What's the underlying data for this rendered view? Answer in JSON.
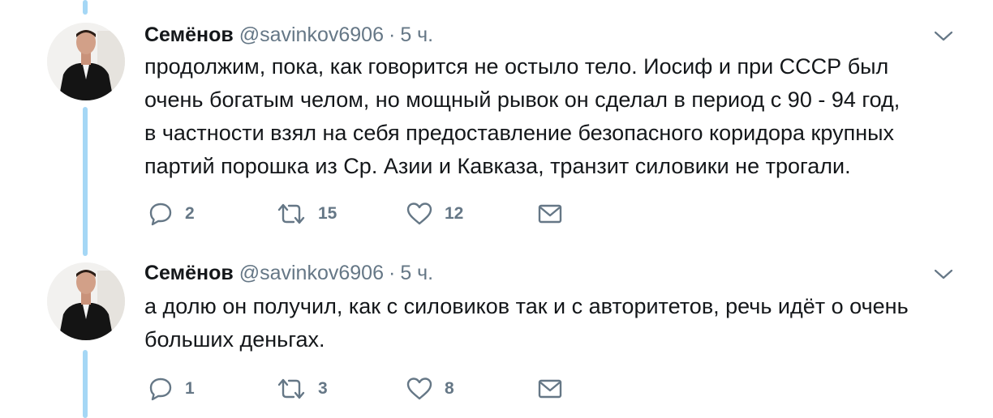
{
  "tweets": [
    {
      "author_name": "Семёнов",
      "handle": "@savinkov6906",
      "separator": "·",
      "time": "5 ч.",
      "text_lines": [
        "продолжим, пока, как говорится не остыло тело. Иосиф и при СССР был",
        "очень богатым челом, но мощный рывок он сделал в период с 90 - 94 год,",
        "в частности взял на себя предоставление безопасного коридора крупных",
        "партий порошка из Ср. Азии и Кавказа, транзит силовики не трогали."
      ],
      "replies": "2",
      "retweets": "15",
      "likes": "12"
    },
    {
      "author_name": "Семёнов",
      "handle": "@savinkov6906",
      "separator": "·",
      "time": "5 ч.",
      "text_lines": [
        "а долю он получил, как с силовиков так и с авторитетов, речь идёт о очень",
        "больших деньгах."
      ],
      "replies": "1",
      "retweets": "3",
      "likes": "8"
    }
  ],
  "icons": {
    "reply": "speech-bubble-icon",
    "retweet": "retweet-arrows-icon",
    "like": "heart-icon",
    "dm": "envelope-icon",
    "menu": "chevron-down-icon"
  },
  "colors": {
    "thread_line": "#a5d7f5",
    "secondary_text": "#657786",
    "primary_text": "#14171a"
  }
}
